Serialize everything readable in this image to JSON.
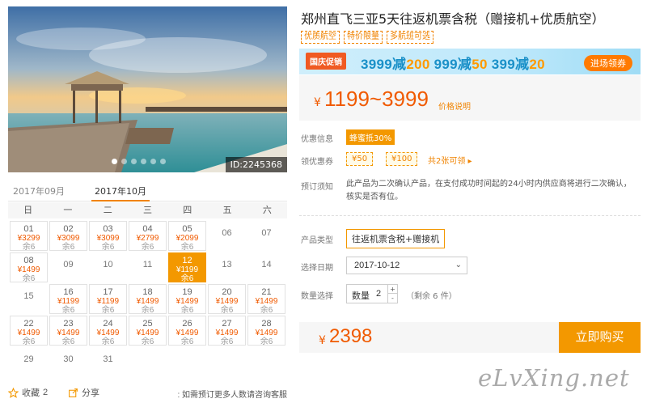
{
  "photo": {
    "id_label": "ID:2245368",
    "dot_count": 6,
    "active_dot": 0
  },
  "calendar": {
    "tabs": [
      "2017年09月",
      "2017年10月"
    ],
    "active_tab": 1,
    "weekdays": [
      "日",
      "一",
      "二",
      "三",
      "四",
      "五",
      "六"
    ],
    "leading_blanks": 0,
    "days": [
      {
        "d": "01",
        "p": "¥3299",
        "s": "余6"
      },
      {
        "d": "02",
        "p": "¥3099",
        "s": "余6"
      },
      {
        "d": "03",
        "p": "¥3099",
        "s": "余6"
      },
      {
        "d": "04",
        "p": "¥2799",
        "s": "余6"
      },
      {
        "d": "05",
        "p": "¥2099",
        "s": "余6"
      },
      {
        "d": "06"
      },
      {
        "d": "07"
      },
      {
        "d": "08",
        "p": "¥1499",
        "s": "余6"
      },
      {
        "d": "09"
      },
      {
        "d": "10"
      },
      {
        "d": "11"
      },
      {
        "d": "12",
        "p": "¥1199",
        "s": "余6",
        "selected": true
      },
      {
        "d": "13"
      },
      {
        "d": "14"
      },
      {
        "d": "15"
      },
      {
        "d": "16",
        "p": "¥1199",
        "s": "余6"
      },
      {
        "d": "17",
        "p": "¥1199",
        "s": "余6"
      },
      {
        "d": "18",
        "p": "¥1499",
        "s": "余6"
      },
      {
        "d": "19",
        "p": "¥1499",
        "s": "余6"
      },
      {
        "d": "20",
        "p": "¥1499",
        "s": "余6"
      },
      {
        "d": "21",
        "p": "¥1499",
        "s": "余6"
      },
      {
        "d": "22",
        "p": "¥1499",
        "s": "余6"
      },
      {
        "d": "23",
        "p": "¥1499",
        "s": "余6"
      },
      {
        "d": "24",
        "p": "¥1499",
        "s": "余6"
      },
      {
        "d": "25",
        "p": "¥1499",
        "s": "余6"
      },
      {
        "d": "26",
        "p": "¥1499",
        "s": "余6"
      },
      {
        "d": "27",
        "p": "¥1499",
        "s": "余6"
      },
      {
        "d": "28",
        "p": "¥1499",
        "s": "余6"
      },
      {
        "d": "29"
      },
      {
        "d": "30"
      },
      {
        "d": "31"
      }
    ]
  },
  "footer": {
    "favorite_label": "收藏",
    "favorite_count": "2",
    "share_label": "分享",
    "consult_text": ": 如需预订更多人数请咨询客服"
  },
  "product": {
    "title": "郑州直飞三亚5天往返机票含税（赠接机+优质航空）",
    "tags": [
      "优质航空",
      "特价限量",
      "多航班可选"
    ]
  },
  "promo": {
    "badge": "国庆促销",
    "deals": [
      {
        "base": "3999减",
        "off": "200"
      },
      {
        "base": "999减",
        "off": "50"
      },
      {
        "base": "399减",
        "off": "20"
      }
    ],
    "button": "进场领券"
  },
  "price": {
    "currency": "¥",
    "range": "1199~3999",
    "explain": "价格说明"
  },
  "offers": {
    "discount_label": "优惠信息",
    "discount_badge": "蜂蜜抵30%",
    "coupon_label": "领优惠券",
    "coupons": [
      "¥50",
      "¥100"
    ],
    "coupon_more": "共2张可领 ▸"
  },
  "notice": {
    "label": "预订须知",
    "text": "此产品为二次确认产品，在支付成功时间起的24小时内供应商将进行二次确认，核实是否有位。"
  },
  "options": {
    "product_type_label": "产品类型",
    "product_type": "往返机票含税+赠接机",
    "date_label": "选择日期",
    "date": "2017-10-12",
    "qty_label": "数量选择",
    "qty_prefix": "数量",
    "qty_value": "2",
    "remain": "（剩余 6 件）"
  },
  "total": {
    "currency": "¥",
    "amount": "2398",
    "buy_button": "立即购买"
  },
  "watermark": "eLvXing.net",
  "colors": {
    "accent": "#f39800",
    "price": "#f05a00",
    "promo_blue": "#1a90c8"
  }
}
